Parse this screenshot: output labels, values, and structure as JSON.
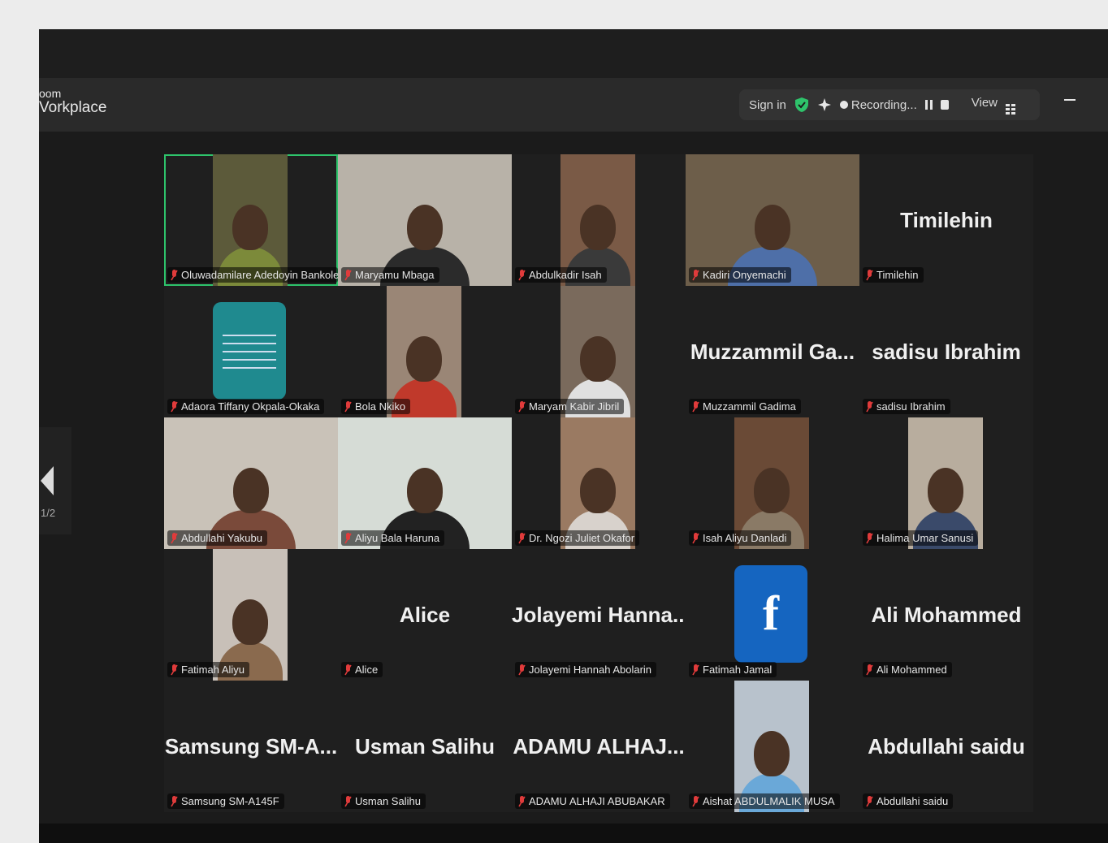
{
  "app": {
    "brand_line1": "oom",
    "brand_line2": "Vorkplace"
  },
  "toolbar": {
    "sign_in_label": "Sign in",
    "recording_label": "Recording...",
    "view_label": "View"
  },
  "pager": {
    "page_label": "1/2"
  },
  "colors": {
    "active_speaker_border": "#2ec36b",
    "facebook_blue": "#1565c0",
    "muted_red": "#e03b3b"
  },
  "participants": [
    {
      "label": "Oluwadamilare Adedoyin Bankole-Ojo",
      "video": "narrow",
      "active": true,
      "bg": "#5c5a3a",
      "body": "#7c8a3a"
    },
    {
      "label": "Maryamu Mbaga",
      "video": "full",
      "bg": "#b8b2a8",
      "body": "#2b2b2b"
    },
    {
      "label": "Abdulkadir Isah",
      "video": "narrow",
      "bg": "#7a5a46",
      "body": "#3a3a3a"
    },
    {
      "label": "Kadiri Onyemachi",
      "video": "full",
      "bg": "#6d5e4a",
      "body": "#4e6fa8"
    },
    {
      "label": "Timilehin",
      "display_name": "Timilehin"
    },
    {
      "label": "Adaora Tiffany Okpala-Okaka",
      "video": "quote"
    },
    {
      "label": "Bola Nkiko",
      "video": "narrow",
      "bg": "#9a8676",
      "body": "#c0392b"
    },
    {
      "label": "Maryam Kabir Jibril",
      "video": "narrow",
      "bg": "#7a6a5c",
      "body": "#e0e0e0"
    },
    {
      "label": "Muzzammil Gadima",
      "display_name": "Muzzammil Ga..."
    },
    {
      "label": "sadisu Ibrahim",
      "display_name": "sadisu Ibrahim"
    },
    {
      "label": "Abdullahi Yakubu",
      "video": "full",
      "bg": "#c9c2b8",
      "body": "#7a4a3a"
    },
    {
      "label": "Aliyu Bala Haruna",
      "video": "full",
      "bg": "#d6dcd6",
      "body": "#222"
    },
    {
      "label": "Dr. Ngozi Juliet Okafor",
      "video": "narrow",
      "bg": "#9a7a62",
      "body": "#d8d2cc"
    },
    {
      "label": "Isah Aliyu Danladi",
      "video": "narrow",
      "bg": "#6a4a36",
      "body": "#8a7a66"
    },
    {
      "label": "Halima Umar Sanusi",
      "video": "narrow",
      "bg": "#b8ad9e",
      "body": "#3a4a6a"
    },
    {
      "label": "Fatimah Aliyu",
      "video": "narrow",
      "bg": "#c8c0b8",
      "body": "#8a6a4e"
    },
    {
      "label": "Alice",
      "display_name": "Alice"
    },
    {
      "label": "Jolayemi Hannah Abolarin",
      "display_name": "Jolayemi  Hanna..."
    },
    {
      "label": "Fatimah Jamal",
      "video": "facebook",
      "logo_text": "f"
    },
    {
      "label": "Ali Mohammed",
      "display_name": "Ali Mohammed"
    },
    {
      "label": "Samsung SM-A145F",
      "display_name": "Samsung  SM-A..."
    },
    {
      "label": "Usman Salihu",
      "display_name": "Usman Salihu"
    },
    {
      "label": "ADAMU ALHAJI ABUBAKAR",
      "display_name": "ADAMU  ALHAJ..."
    },
    {
      "label": "Aishat ABDULMALIK MUSA",
      "video": "narrow",
      "bg": "#b8c2cc",
      "body": "#6aa8d8"
    },
    {
      "label": "Abdullahi saidu",
      "display_name": "Abdullahi saidu"
    }
  ]
}
